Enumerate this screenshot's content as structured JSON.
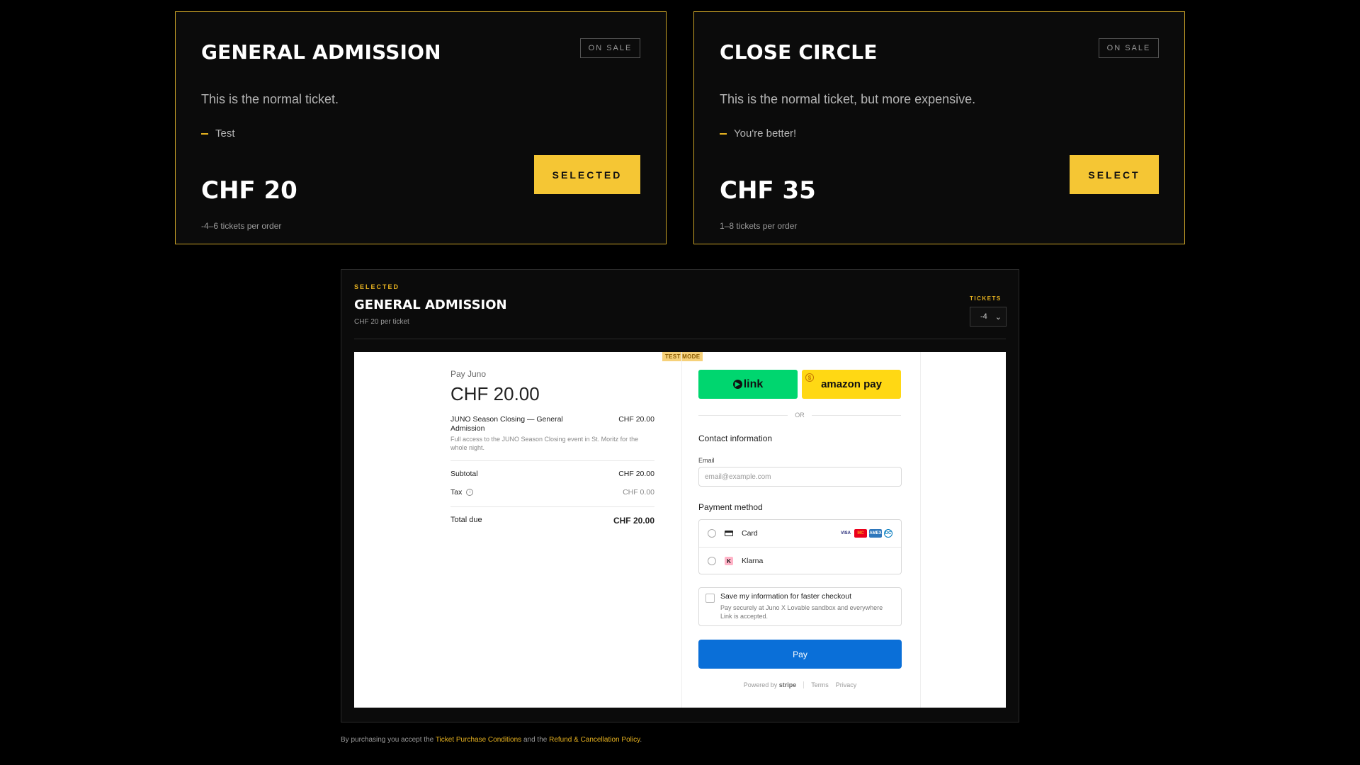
{
  "tickets": [
    {
      "title": "GENERAL ADMISSION",
      "badge": "ON SALE",
      "description": "This is the normal ticket.",
      "feature": "Test",
      "price": "CHF 20",
      "limit": "-4–6 tickets per order",
      "button": "SELECTED"
    },
    {
      "title": "CLOSE CIRCLE",
      "badge": "ON SALE",
      "description": "This is the normal ticket, but more expensive.",
      "feature": "You're better!",
      "price": "CHF 35",
      "limit": "1–8 tickets per order",
      "button": "SELECT"
    }
  ],
  "selected": {
    "label": "SELECTED",
    "title": "GENERAL ADMISSION",
    "subtitle": "CHF 20 per ticket",
    "tickets_label": "TICKETS",
    "tickets_value": "-4"
  },
  "stripe": {
    "test_mode": "TEST MODE",
    "pay_to": "Pay Juno",
    "amount": "CHF 20.00",
    "item_name": "JUNO Season Closing — General Admission",
    "item_price": "CHF 20.00",
    "item_desc": "Full access to the JUNO Season Closing event in St. Moritz for the whole night.",
    "subtotal_label": "Subtotal",
    "subtotal": "CHF 20.00",
    "tax_label": "Tax",
    "tax": "CHF 0.00",
    "total_label": "Total due",
    "total": "CHF 20.00",
    "link_label": "link",
    "amazon_label": "amazon pay",
    "or": "OR",
    "contact_heading": "Contact information",
    "email_label": "Email",
    "email_placeholder": "email@example.com",
    "payment_heading": "Payment method",
    "card_label": "Card",
    "klarna_label": "Klarna",
    "brands": [
      "VISA",
      "MC",
      "AMEX",
      "DC"
    ],
    "save_title": "Save my information for faster checkout",
    "save_sub": "Pay securely at Juno X Lovable sandbox and everywhere Link is accepted.",
    "pay_button": "Pay",
    "powered_by": "Powered by",
    "stripe_word": "stripe",
    "terms": "Terms",
    "privacy": "Privacy"
  },
  "legal": {
    "prefix": "By purchasing you accept the",
    "link1": "Ticket Purchase Conditions",
    "mid": "and the",
    "link2": "Refund & Cancellation Policy",
    "suffix": "."
  },
  "colors": {
    "accent": "#e8b320",
    "button_yellow": "#f5c634",
    "link_green": "#00d66f",
    "stripe_blue": "#0a6fd8"
  }
}
